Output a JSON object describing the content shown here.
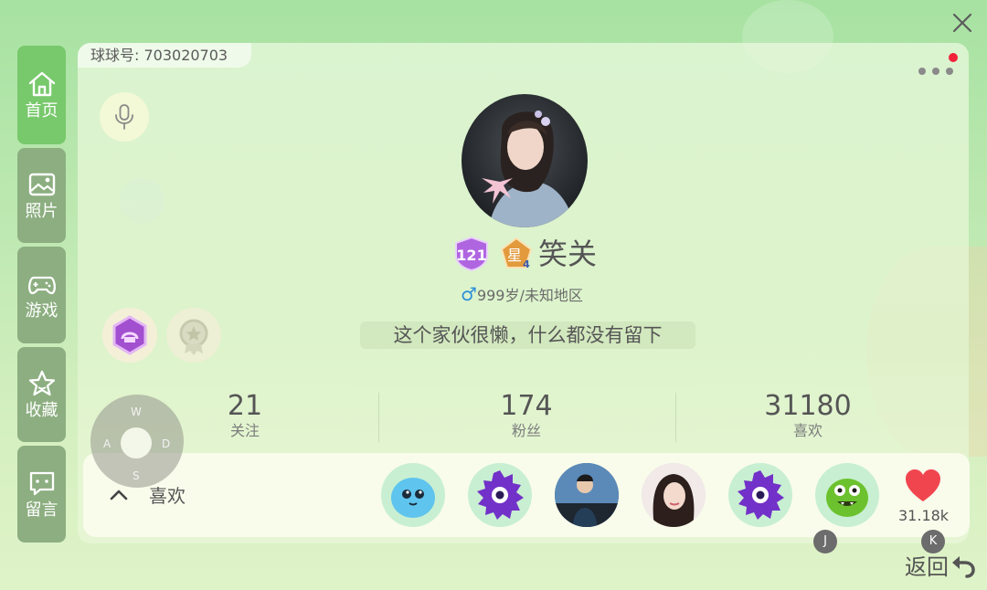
{
  "header": {
    "account_id": "球球号: 703020703"
  },
  "sidebar": {
    "items": [
      {
        "label": "首页",
        "icon": "home-icon",
        "active": true
      },
      {
        "label": "照片",
        "icon": "photo-icon",
        "active": false
      },
      {
        "label": "游戏",
        "icon": "gamepad-icon",
        "active": false
      },
      {
        "label": "收藏",
        "icon": "star-icon",
        "active": false
      },
      {
        "label": "留言",
        "icon": "message-icon",
        "active": false
      }
    ]
  },
  "profile": {
    "level": "121",
    "star_rank": "星",
    "star_level": "4",
    "nickname": "笑关",
    "gender_symbol": "♂",
    "age_region": "999岁/未知地区",
    "bio": "这个家伙很懒，什么都没有留下"
  },
  "stats": [
    {
      "value": "21",
      "label": "关注"
    },
    {
      "value": "174",
      "label": "粉丝"
    },
    {
      "value": "31180",
      "label": "喜欢"
    }
  ],
  "joystick": {
    "up": "W",
    "left": "A",
    "right": "D",
    "down": "S"
  },
  "likes": {
    "label": "喜欢",
    "count": "31.18k",
    "key_j": "J",
    "key_k": "K"
  },
  "footer": {
    "back_label": "返回"
  },
  "colors": {
    "accent_green": "#78c86c",
    "sidebar_bg": "#8cae80",
    "heart": "#f0454f",
    "notify_dot": "#f0233a"
  }
}
